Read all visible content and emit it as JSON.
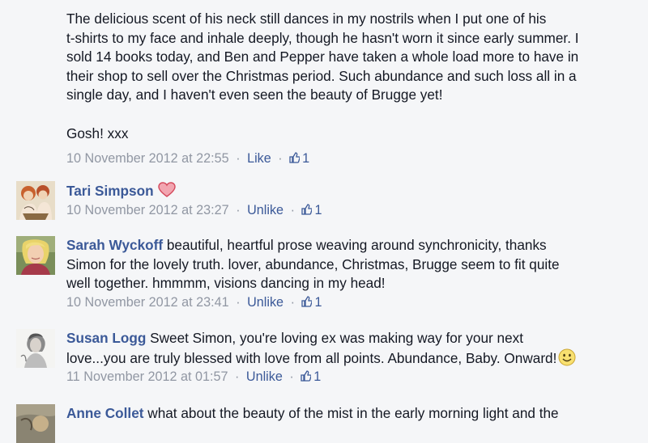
{
  "post": {
    "lines": [
      "The delicious scent of his neck still dances in my nostrils when I put one of his",
      "t-shirts to my face and inhale deeply, though he hasn't worn it since early summer. I",
      "sold 14 books today, and Ben and Pepper have taken a whole load more to have in",
      "their shop to sell over the Christmas period. Such abundance and such loss all in a",
      "single day, and I haven't even seen the beauty of Brugge yet!"
    ],
    "closing": "Gosh! xxx",
    "timestamp": "10 November 2012 at 22:55",
    "like_label": "Like",
    "like_count": "1"
  },
  "comments": [
    {
      "author": "Tari Simpson",
      "text_lines": [],
      "emoji": "heart-icon",
      "timestamp": "10 November 2012 at 23:27",
      "action_label": "Unlike",
      "like_count": "1"
    },
    {
      "author": "Sarah Wyckoff",
      "text_lines": [
        " beautiful, heartful prose weaving around synchronicity, thanks",
        "Simon for the lovely truth. lover, abundance, Christmas, Brugge seem to fit quite",
        "well together. hmmmm, visions dancing in my head!"
      ],
      "timestamp": "10 November 2012 at 23:41",
      "action_label": "Unlike",
      "like_count": "1"
    },
    {
      "author": "Susan Logg",
      "text_lines": [
        " Sweet Simon, you're loving ex was making way for your next",
        "love...you are truly blessed with love from all points. Abundance, Baby. Onward!"
      ],
      "emoji": "smiley-icon",
      "timestamp": "11 November 2012 at 01:57",
      "action_label": "Unlike",
      "like_count": "1"
    },
    {
      "author": "Anne Collet",
      "text_lines": [
        " what about the beauty of the mist in the early morning light and the"
      ]
    }
  ],
  "separator": "·",
  "colors": {
    "link": "#3b5998",
    "meta": "#9197a3",
    "text": "#141823",
    "background": "#f5f6f8"
  }
}
